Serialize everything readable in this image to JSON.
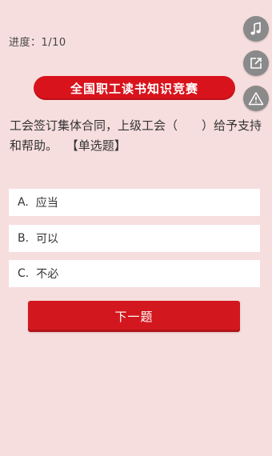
{
  "progress": {
    "text": "进度：1/10"
  },
  "title": "全国职工读书知识竞赛",
  "question": {
    "text": "工会签订集体合同，上级工会（　　）给予支持和帮助。",
    "type_tag": "【单选题】"
  },
  "options": [
    {
      "letter": "A.",
      "text": "应当"
    },
    {
      "letter": "B.",
      "text": "可以"
    },
    {
      "letter": "C.",
      "text": "不必"
    }
  ],
  "next_button": {
    "label": "下一题"
  },
  "side_buttons": [
    {
      "icon": "music-note-icon"
    },
    {
      "icon": "share-icon"
    },
    {
      "icon": "warning-icon"
    }
  ],
  "colors": {
    "background": "#f7dede",
    "accent_red": "#d8131c",
    "side_button_gray": "#8a8a8a"
  }
}
